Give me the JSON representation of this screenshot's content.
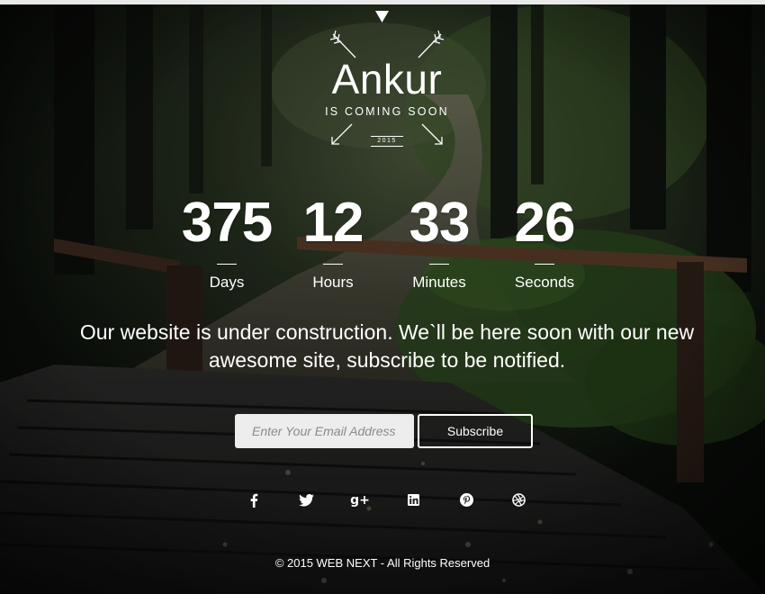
{
  "brand": {
    "name": "Ankur",
    "tagline": "IS COMING SOON",
    "year": "2015"
  },
  "countdown": [
    {
      "value": "375",
      "label": "Days"
    },
    {
      "value": "12",
      "label": "Hours"
    },
    {
      "value": "33",
      "label": "Minutes"
    },
    {
      "value": "26",
      "label": "Seconds"
    }
  ],
  "message": "Our website is under construction. We`ll be here soon with our new awesome site, subscribe to be notified.",
  "subscribe": {
    "placeholder": "Enter Your Email Address",
    "value": "",
    "button_label": "Subscribe"
  },
  "social": [
    "facebook-icon",
    "twitter-icon",
    "google-plus-icon",
    "linkedin-icon",
    "pinterest-icon",
    "dribbble-icon"
  ],
  "social_labels": {
    "google_plus": "g+"
  },
  "footer": "© 2015 WEB NEXT - All Rights Reserved",
  "colors": {
    "text": "#ffffff",
    "input_bg": "#ededed",
    "placeholder": "#8a8a8a",
    "top_bar": "#e9e9e9"
  }
}
